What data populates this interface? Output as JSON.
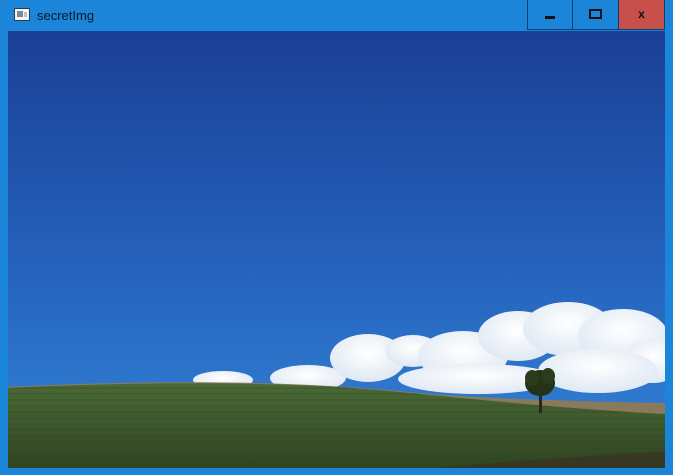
{
  "window": {
    "title": "secretImg",
    "minimize_label": "",
    "maximize_label": "",
    "close_label": "x"
  },
  "image": {
    "subject": "landscape-blue-sky-clouds-green-field-tree"
  },
  "colors": {
    "titlebar": "#1b86d9",
    "close_button": "#c7504b",
    "sky_top": "#1b3f95",
    "sky_bottom": "#2e7bd0",
    "field": "#3e5a2d"
  }
}
